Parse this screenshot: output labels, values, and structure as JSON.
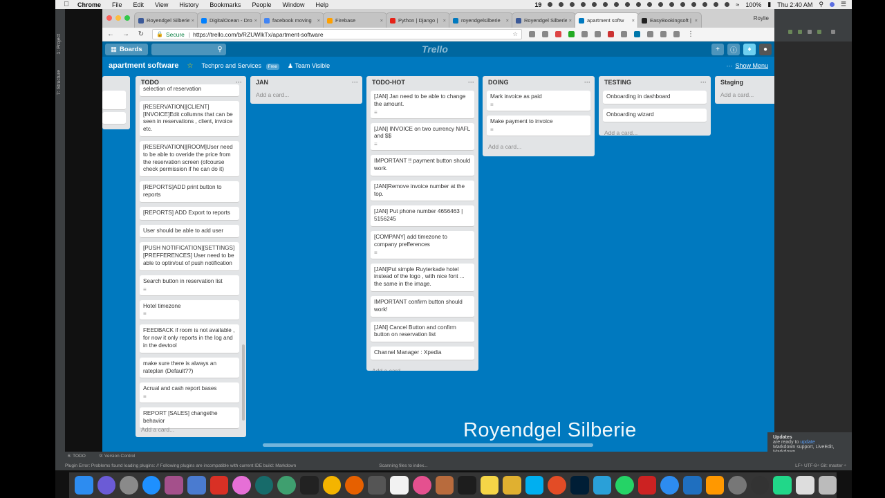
{
  "menubar": {
    "apple_icon": "apple-icon",
    "items": [
      "Chrome",
      "File",
      "Edit",
      "View",
      "History",
      "Bookmarks",
      "People",
      "Window",
      "Help"
    ],
    "notif_count": "19",
    "battery": "100%",
    "clock": "Thu 2:40 AM",
    "user": "Roylie"
  },
  "ide": {
    "vtabs": [
      "1: Project",
      "7: Structure"
    ],
    "bottom_tabs": [
      "6: TODO",
      "9: Version Control"
    ],
    "status_left": "Plugin Error: Problems found loading plugins: // Following plugins are incompatible with current IDE build: Markdown",
    "status_mid": "Scanning files to index...",
    "status_right": "LF÷  UTF-8÷  Git: master ÷",
    "updates_title": "Updates",
    "updates_text": "are ready to",
    "updates_link": "update",
    "updates_text2": "Markdown support, LiveEdit, Markdown..."
  },
  "browser": {
    "tabs": [
      {
        "label": "Royendgel Silberie",
        "color": "#3b5998"
      },
      {
        "label": "DigitalOcean - Dro",
        "color": "#0080ff"
      },
      {
        "label": "facebook moving",
        "color": "#4285f4"
      },
      {
        "label": "Firebase",
        "color": "#ffa000"
      },
      {
        "label": "Python | Django |",
        "color": "#e62117"
      },
      {
        "label": "royendgelsilberie",
        "color": "#3b5998"
      },
      {
        "label": "Royendgel Silberie",
        "color": "#3b5998"
      },
      {
        "label": "apartment softw",
        "color": "#0079bf"
      },
      {
        "label": "EasyBookingsoft |",
        "color": "#222222"
      }
    ],
    "profile": "Roylie",
    "url_secure": "Secure",
    "url": "https://trello.com/b/RZUWlkTx/apartment-software"
  },
  "trello": {
    "boards_label": "Boards",
    "logo": "Trello",
    "board_name": "apartment software",
    "team": "Techpro and Services",
    "free_label": "Free",
    "visibility": "Team Visible",
    "show_menu": "Show Menu",
    "add_card": "Add a card...",
    "lists": {
      "todo": {
        "title": "TODO",
        "cards": [
          "selection of reservation",
          "[RESERVATION][CLIENT][INVOICE]Edit collumns that can be seen in reservations , client, invoice etc.",
          "[RESERVATION][ROOM]User need to be able to overide the price from the reservation screen (ofcourse check permission if he can do it)",
          "[REPORTS]ADD print button to reports",
          "[REPORTS] ADD Export to reports",
          "User should be able to add user",
          "[PUSH NOTIFICATION][SETTINGS][PREFFERENCES] User need to be able to optin/out of push notification",
          "Search button in reservation list",
          "Hotel timezone",
          "FEEDBACK if room is not available , for now it only reports in the log and in the devtool",
          "make sure there is always an rateplan (Default??)",
          "Acrual and cash report bases",
          "REPORT [SALES] changethe behavior"
        ]
      },
      "jan": {
        "title": "JAN",
        "cards": []
      },
      "todo_hot": {
        "title": "TODO-HOT",
        "cards": [
          "[JAN] Jan need to be able to change the amount.",
          "[JAN] INVOICE on two currency NAFL and $$",
          "IMPORTANT !! payment button should work.",
          "[JAN]Remove invoice number at the top.",
          "[JAN] Put phone number 4656463 | 5156245",
          "[COMPANY] add timezone to company prefferences",
          "[JAN]Put simple Ruyterkade hotel instead of the logo , with nice font ... the same in the image.",
          "IMPORTANT confirm button should work!",
          "[JAN] Cancel Button and confirm button on reservation list",
          "Channel Manager : Xpedia"
        ]
      },
      "doing": {
        "title": "DOING",
        "cards": [
          "Mark invoice as paid",
          "Make payment to invoice"
        ]
      },
      "testing": {
        "title": "TESTING",
        "cards": [
          "Onboarding in dashboard",
          "Onboarding wizard"
        ]
      },
      "staging": {
        "title": "Staging",
        "cards": []
      }
    }
  },
  "watermark": "Royendgel Silberie"
}
